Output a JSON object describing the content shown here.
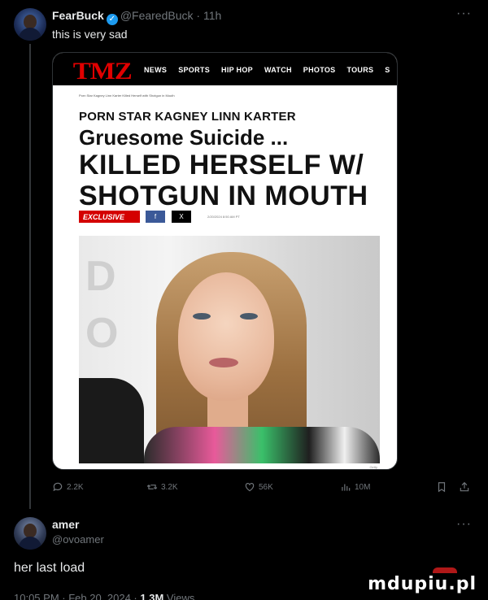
{
  "post": {
    "author_name": "FearBuck",
    "author_handle": "@FearedBuck",
    "time_ago": "11h",
    "text": "this is very sad",
    "more": "···"
  },
  "media": {
    "logo": "TMZ",
    "nav": [
      "NEWS",
      "SPORTS",
      "HIP HOP",
      "WATCH",
      "PHOTOS",
      "TOURS",
      "S"
    ],
    "breadcrumb": "Porn Star Kagney Linn Karter Killed Herself with Shotgun in Mouth",
    "kicker": "PORN STAR KAGNEY LINN KARTER",
    "headline_1": "Gruesome Suicide ...",
    "headline_2": "KILLED HERSELF W/",
    "headline_3": "SHOTGUN IN MOUTH",
    "exclusive": "EXCLUSIVE",
    "share_fb": "f",
    "share_x": "X",
    "date": "2/20/2024 8:50 AM PT",
    "credit": "Getty"
  },
  "actions": {
    "replies": "2.2K",
    "reposts": "3.2K",
    "likes": "56K",
    "views": "10M"
  },
  "reply": {
    "author_name": "amer",
    "author_handle": "@ovoamer",
    "text": "her last load",
    "more": "···",
    "meta_time": "10:05 PM · Feb 20, 2024 · ",
    "meta_views": "1.3M",
    "meta_views_label": " Views"
  },
  "watermark": "mdupiu.pl"
}
